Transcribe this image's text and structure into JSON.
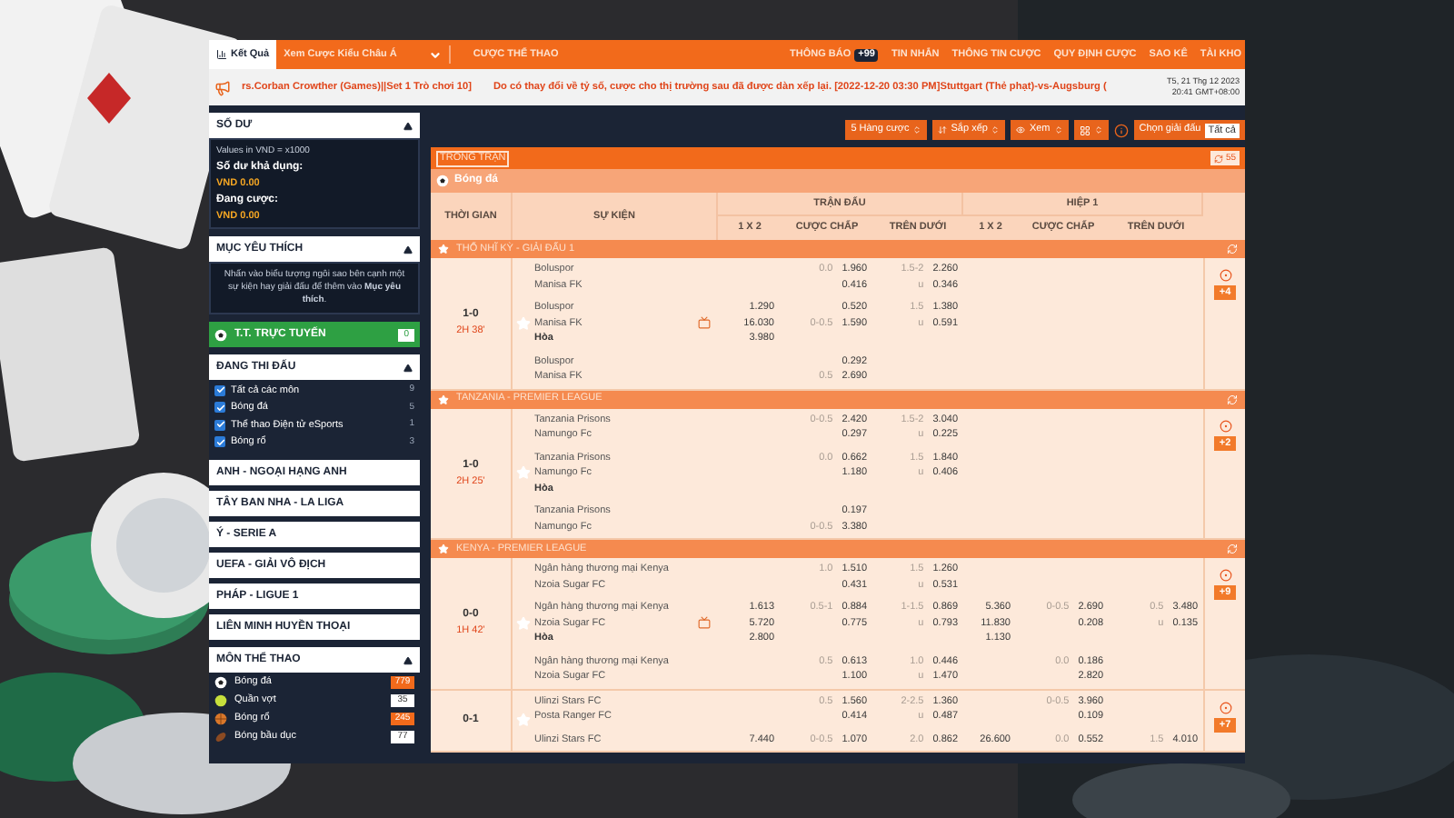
{
  "nav": {
    "results_tab": "Kết Quả",
    "odds_view": "Xem Cược Kiểu Châu Á",
    "sports_link": "CƯỢC THỂ THAO",
    "links": [
      {
        "label": "THÔNG BÁO",
        "badge": "+99"
      },
      {
        "label": "TIN NHẮN"
      },
      {
        "label": "THÔNG TIN CƯỢC"
      },
      {
        "label": "QUY ĐỊNH CƯỢC"
      },
      {
        "label": "SAO KÊ"
      },
      {
        "label": "TÀI KHO"
      }
    ]
  },
  "ticker": {
    "messages": [
      "rs.Corban Crowther (Games)||Set 1 Trò chơi 10]",
      "Do có thay đổi về tỷ số, cược cho thị trường sau đã được dàn xếp lại. [2022-12-20 03:30 PM]Stuttgart (Thẻ phạt)-vs-Augsburg ("
    ],
    "date": "T5, 21 Thg 12 2023",
    "time": "20:41 GMT+08:00"
  },
  "sidebar": {
    "balance": {
      "title": "SỐ DƯ",
      "note": "Values in VND = x1000",
      "rows": [
        {
          "label": "Số dư khả dụng:",
          "value": "VND 0.00"
        },
        {
          "label": "Đang cược:",
          "value": "VND 0.00"
        }
      ]
    },
    "favorites": {
      "title": "MỤC YÊU THÍCH",
      "hint": "Nhấn vào biểu tượng ngôi sao bên cạnh một sự kiện hay giải đấu để thêm vào **Mục yêu thích**."
    },
    "live_button": {
      "label": "T.T. TRỰC TUYẾN",
      "count": "0"
    },
    "in_play": {
      "title": "ĐANG THI ĐẤU",
      "items": [
        {
          "label": "Tất cả các môn",
          "count": "9",
          "checked": true
        },
        {
          "label": "Bóng đá",
          "count": "5",
          "checked": true
        },
        {
          "label": "Thể thao Điện tử eSports",
          "count": "1",
          "checked": true
        },
        {
          "label": "Bóng rổ",
          "count": "3",
          "checked": true
        }
      ]
    },
    "leagues": [
      "ANH - NGOẠI HẠNG ANH",
      "TÂY BAN NHA - LA LIGA",
      "Ý - SERIE A",
      "UEFA - GIẢI VÔ ĐỊCH",
      "PHÁP - LIGUE 1",
      "LIÊN MINH HUYỀN THOẠI"
    ],
    "sports": {
      "title": "MÔN THỂ THAO",
      "items": [
        {
          "kind": "soccer",
          "label": "Bóng đá",
          "count": "779",
          "color": "#f26a1b"
        },
        {
          "kind": "tennis",
          "label": "Quần vợt",
          "count": "35",
          "color": "#ffffff"
        },
        {
          "kind": "basketball",
          "label": "Bóng rổ",
          "count": "245",
          "color": "#f26a1b"
        },
        {
          "kind": "football",
          "label": "Bóng bầu dục",
          "count": "77",
          "color": "#ffffff"
        }
      ]
    }
  },
  "toolbar": {
    "rows_select": "5 Hàng cược",
    "sort_select": "Sắp xếp",
    "view_select": "Xem",
    "league_picker": {
      "label": "Chọn giải đấu",
      "value": "Tất cả"
    }
  },
  "market": {
    "title": "TRONG TRẬN",
    "refresh_count": "55",
    "sport": "Bóng đá",
    "columns": {
      "time": "THỜI GIAN",
      "event": "SỰ KIỆN",
      "groups": [
        {
          "title": "TRẬN ĐẤU",
          "cols": [
            "1 X 2",
            "CƯỢC CHẤP",
            "TRÊN DƯỚI"
          ]
        },
        {
          "title": "HIỆP 1",
          "cols": [
            "1 X 2",
            "CƯỢC CHẤP",
            "TRÊN DƯỚI"
          ]
        }
      ]
    },
    "leagues": [
      {
        "name": "THỔ NHĨ KỲ - GIẢI ĐẤU 1",
        "matches": [
          {
            "score": "1-0",
            "time": "2H 38'",
            "tv": true,
            "more": "+4",
            "lines": [
              {
                "home": "Boluspor",
                "away": "Manisa FK",
                "ft_hdp": [
                  {
                    "line": "0.0",
                    "odds": "1.960"
                  },
                  {
                    "odds": "0.416"
                  }
                ],
                "ft_ou": [
                  {
                    "line": "1.5-2",
                    "odds": "2.260"
                  },
                  {
                    "line": "u",
                    "odds": "0.346"
                  }
                ]
              },
              {
                "home": "Boluspor",
                "away": "Manisa FK",
                "draw": "Hòa",
                "ft_x12": [
                  "1.290",
                  "16.030",
                  "3.980"
                ],
                "ft_hdp": [
                  {
                    "odds": "0.520"
                  },
                  {
                    "line": "0-0.5",
                    "odds": "1.590"
                  }
                ],
                "ft_ou": [
                  {
                    "line": "1.5",
                    "odds": "1.380"
                  },
                  {
                    "line": "u",
                    "odds": "0.591"
                  }
                ]
              },
              {
                "home": "Boluspor",
                "away": "Manisa FK",
                "ft_hdp": [
                  {
                    "odds": "0.292"
                  },
                  {
                    "line": "0.5",
                    "odds": "2.690"
                  }
                ]
              }
            ]
          }
        ]
      },
      {
        "name": "TANZANIA - PREMIER LEAGUE",
        "matches": [
          {
            "score": "1-0",
            "time": "2H 25'",
            "tv": false,
            "more": "+2",
            "lines": [
              {
                "home": "Tanzania Prisons",
                "away": "Namungo Fc",
                "ft_hdp": [
                  {
                    "line": "0-0.5",
                    "odds": "2.420"
                  },
                  {
                    "odds": "0.297"
                  }
                ],
                "ft_ou": [
                  {
                    "line": "1.5-2",
                    "odds": "3.040"
                  },
                  {
                    "line": "u",
                    "odds": "0.225"
                  }
                ]
              },
              {
                "home": "Tanzania Prisons",
                "away": "Namungo Fc",
                "draw": "Hòa",
                "ft_hdp": [
                  {
                    "line": "0.0",
                    "odds": "0.662"
                  },
                  {
                    "odds": "1.180"
                  }
                ],
                "ft_ou": [
                  {
                    "line": "1.5",
                    "odds": "1.840"
                  },
                  {
                    "line": "u",
                    "odds": "0.406"
                  }
                ]
              },
              {
                "home": "Tanzania Prisons",
                "away": "Namungo Fc",
                "ft_hdp": [
                  {
                    "odds": "0.197"
                  },
                  {
                    "line": "0-0.5",
                    "odds": "3.380"
                  }
                ]
              }
            ]
          }
        ]
      },
      {
        "name": "KENYA - PREMIER LEAGUE",
        "matches": [
          {
            "score": "0-0",
            "time": "1H 42'",
            "tv": true,
            "more": "+9",
            "lines": [
              {
                "home": "Ngân hàng thương mại Kenya",
                "away": "Nzoia Sugar FC",
                "ft_hdp": [
                  {
                    "line": "1.0",
                    "odds": "1.510"
                  },
                  {
                    "odds": "0.431"
                  }
                ],
                "ft_ou": [
                  {
                    "line": "1.5",
                    "odds": "1.260"
                  },
                  {
                    "line": "u",
                    "odds": "0.531"
                  }
                ]
              },
              {
                "home": "Ngân hàng thương mại Kenya",
                "away": "Nzoia Sugar FC",
                "draw": "Hòa",
                "ft_x12": [
                  "1.613",
                  "5.720",
                  "2.800"
                ],
                "ft_hdp": [
                  {
                    "line": "0.5-1",
                    "odds": "0.884"
                  },
                  {
                    "odds": "0.775"
                  }
                ],
                "ft_ou": [
                  {
                    "line": "1-1.5",
                    "odds": "0.869"
                  },
                  {
                    "line": "u",
                    "odds": "0.793"
                  }
                ],
                "h1_x12": [
                  "5.360",
                  "11.830",
                  "1.130"
                ],
                "h1_hdp": [
                  {
                    "line": "0-0.5",
                    "odds": "2.690"
                  },
                  {
                    "odds": "0.208"
                  }
                ],
                "h1_ou": [
                  {
                    "line": "0.5",
                    "odds": "3.480"
                  },
                  {
                    "line": "u",
                    "odds": "0.135"
                  }
                ]
              },
              {
                "home": "Ngân hàng thương mại Kenya",
                "away": "Nzoia Sugar FC",
                "ft_hdp": [
                  {
                    "line": "0.5",
                    "odds": "0.613"
                  },
                  {
                    "odds": "1.100"
                  }
                ],
                "ft_ou": [
                  {
                    "line": "1.0",
                    "odds": "0.446"
                  },
                  {
                    "line": "u",
                    "odds": "1.470"
                  }
                ],
                "h1_hdp": [
                  {
                    "line": "0.0",
                    "odds": "0.186"
                  },
                  {
                    "odds": "2.820"
                  }
                ]
              }
            ]
          },
          {
            "score": "0-1",
            "tv": false,
            "more": "+7",
            "lines": [
              {
                "home": "Ulinzi Stars FC",
                "away": "Posta Ranger FC",
                "ft_hdp": [
                  {
                    "line": "0.5",
                    "odds": "1.560"
                  },
                  {
                    "odds": "0.414"
                  }
                ],
                "ft_ou": [
                  {
                    "line": "2-2.5",
                    "odds": "1.360"
                  },
                  {
                    "line": "u",
                    "odds": "0.487"
                  }
                ],
                "h1_hdp": [
                  {
                    "line": "0-0.5",
                    "odds": "3.960"
                  },
                  {
                    "odds": "0.109"
                  }
                ]
              },
              {
                "home": "Ulinzi Stars FC",
                "ft_x12": [
                  "7.440"
                ],
                "ft_hdp": [
                  {
                    "line": "0-0.5",
                    "odds": "1.070"
                  }
                ],
                "ft_ou": [
                  {
                    "line": "2.0",
                    "odds": "0.862"
                  }
                ],
                "h1_x12": [
                  "26.600"
                ],
                "h1_hdp": [
                  {
                    "line": "0.0",
                    "odds": "0.552"
                  }
                ],
                "h1_ou": [
                  {
                    "line": "1.5",
                    "odds": "4.010"
                  }
                ]
              }
            ]
          }
        ]
      }
    ]
  }
}
